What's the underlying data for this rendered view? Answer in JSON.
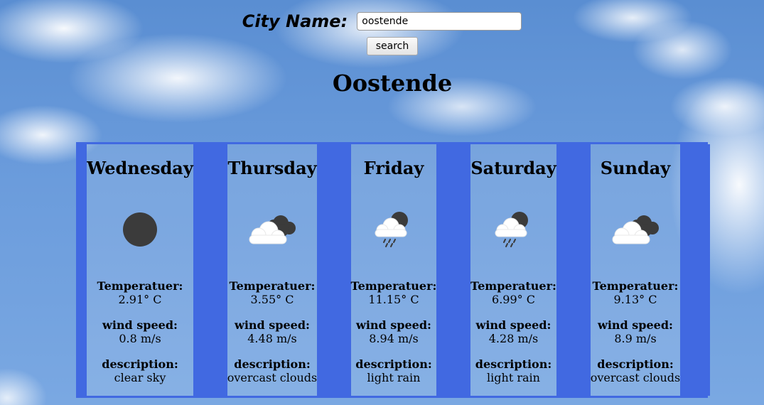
{
  "search": {
    "label": "City Name:",
    "value": "oostende",
    "button_label": "search"
  },
  "city": "Oostende",
  "labels": {
    "temperature": "Temperatuer:",
    "wind": "wind speed:",
    "description": "description:"
  },
  "days": [
    {
      "name": "Wednesday",
      "temperature": "2.91° C",
      "wind": "0.8 m/s",
      "description": "clear sky",
      "icon": "clear-sky-icon"
    },
    {
      "name": "Thursday",
      "temperature": "3.55° C",
      "wind": "4.48 m/s",
      "description": "overcast clouds",
      "icon": "overcast-clouds-icon"
    },
    {
      "name": "Friday",
      "temperature": "11.15° C",
      "wind": "8.94 m/s",
      "description": "light rain",
      "icon": "light-rain-icon"
    },
    {
      "name": "Saturday",
      "temperature": "6.99° C",
      "wind": "4.28 m/s",
      "description": "light rain",
      "icon": "light-rain-icon"
    },
    {
      "name": "Sunday",
      "temperature": "9.13° C",
      "wind": "8.9 m/s",
      "description": "overcast clouds",
      "icon": "overcast-clouds-icon"
    }
  ],
  "colors": {
    "panel": "#4169e1"
  }
}
